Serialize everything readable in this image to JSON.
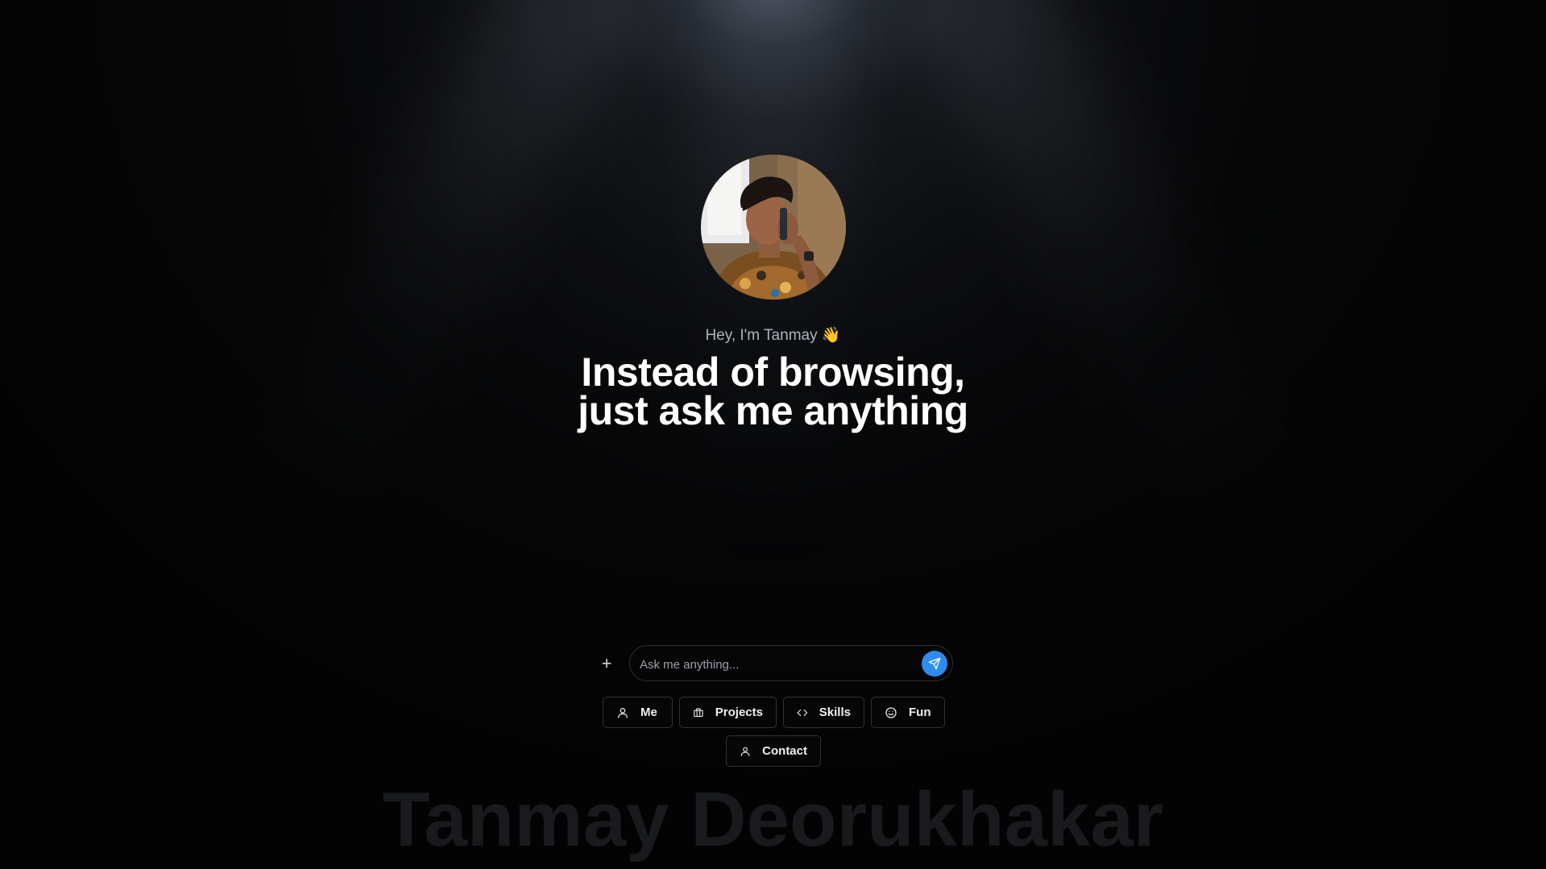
{
  "hero": {
    "greeting": "Hey, I'm Tanmay 👋",
    "headline_line1": "Instead of browsing,",
    "headline_line2": "just ask me anything"
  },
  "chat": {
    "add_symbol": "+",
    "placeholder": "Ask me anything...",
    "send_icon": "send-icon",
    "accent_color": "#2f8cf0"
  },
  "quick_actions": [
    {
      "label": "Me",
      "icon": "user-icon"
    },
    {
      "label": "Projects",
      "icon": "briefcase-icon"
    },
    {
      "label": "Skills",
      "icon": "code-icon"
    },
    {
      "label": "Fun",
      "icon": "smile-icon"
    },
    {
      "label": "Contact",
      "icon": "user-icon"
    }
  ],
  "footer": {
    "watermark": "Tanmay Deorukhakar"
  }
}
